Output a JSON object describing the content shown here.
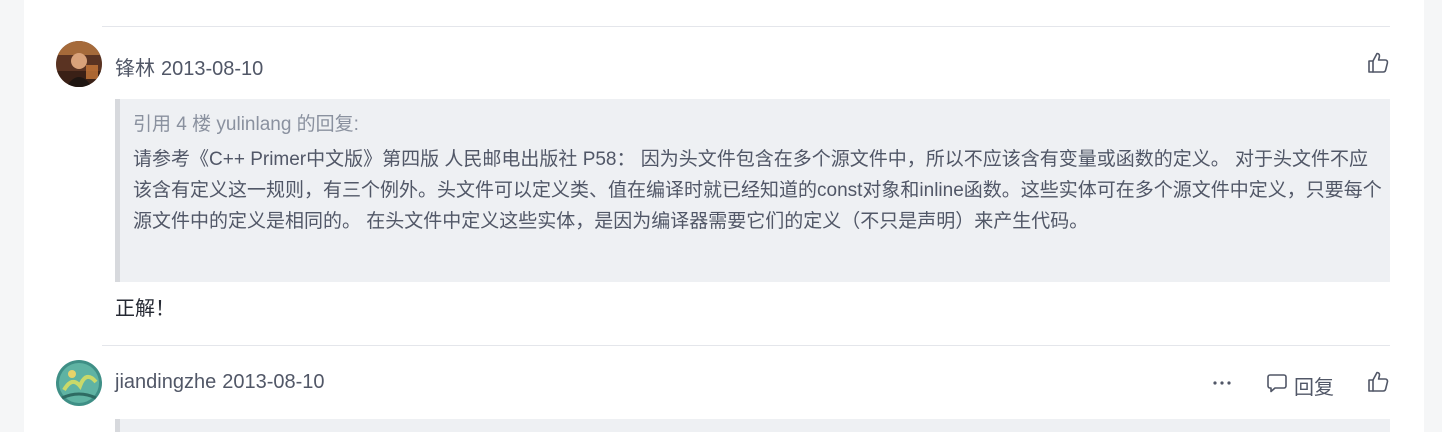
{
  "comments": [
    {
      "author": "锋林",
      "date": "2013-08-10",
      "avatar_icon": "user-avatar-photo",
      "like_icon": "thumbs-up-icon",
      "quote": {
        "header": "引用 4 楼 yulinlang 的回复:",
        "body": "请参考《C++ Primer中文版》第四版 人民邮电出版社 P58： 因为头文件包含在多个源文件中，所以不应该含有变量或函数的定义。 对于头文件不应该含有定义这一规则，有三个例外。头文件可以定义类、值在编译时就已经知道的const对象和inline函数。这些实体可在多个源文件中定义，只要每个源文件中的定义是相同的。 在头文件中定义这些实体，是因为编译器需要它们的定义（不只是声明）来产生代码。"
      },
      "text": "正解！"
    },
    {
      "author": "jiandingzhe",
      "date": "2013-08-10",
      "avatar_icon": "user-avatar-image",
      "more_icon": "more-icon",
      "reply_label": "回复",
      "reply_icon": "comment-icon",
      "like_icon": "thumbs-up-icon"
    }
  ],
  "colors": {
    "page_background": "#f5f6f7",
    "card_background": "#ffffff",
    "quote_background": "#eef0f3",
    "quote_border": "#d7d9dd",
    "meta_text": "#515767",
    "quote_header_text": "#8a919f"
  }
}
